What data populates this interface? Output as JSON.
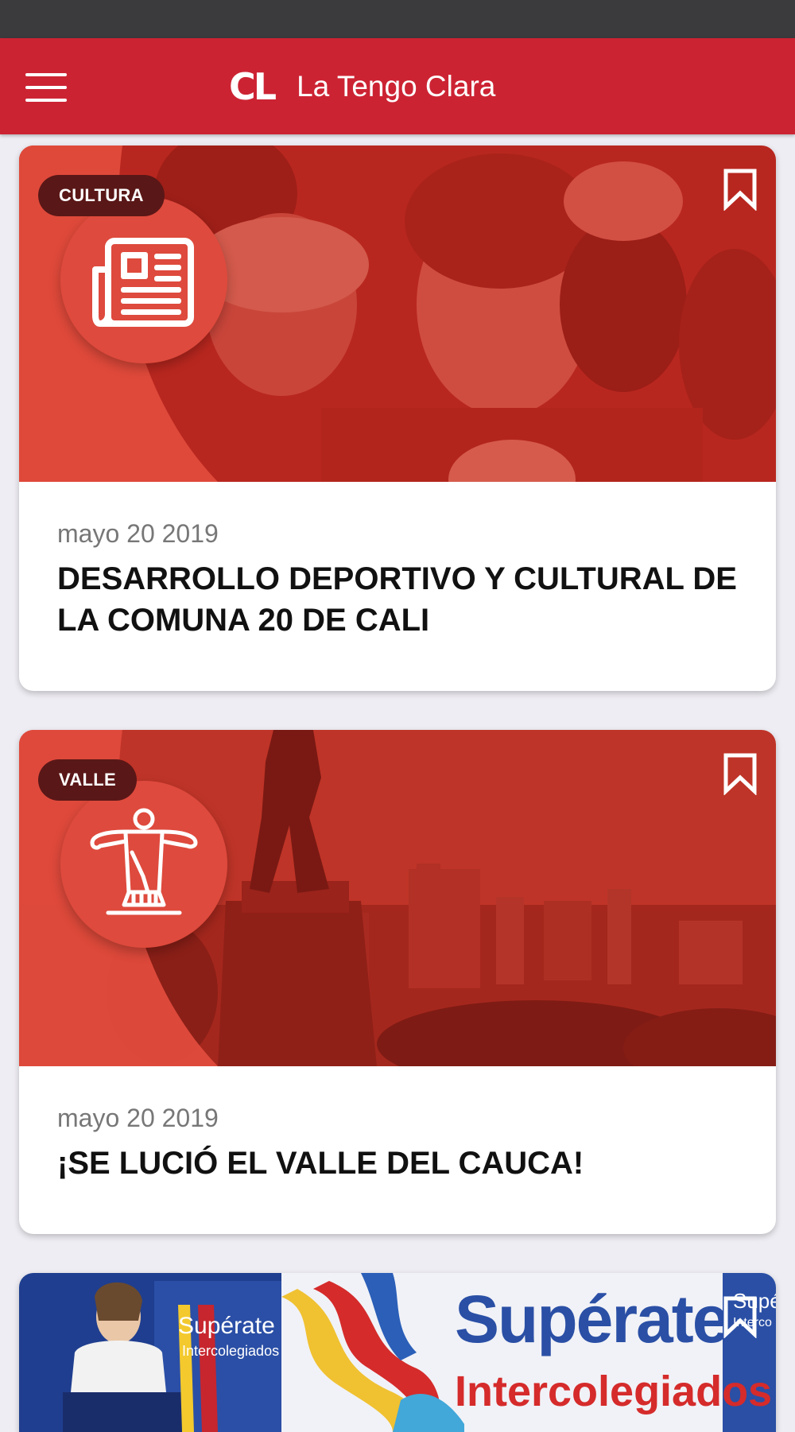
{
  "app_bar": {
    "logo_text": "CL",
    "title": "La Tengo Clara",
    "bg_color": "#cc2333"
  },
  "cards": [
    {
      "category": "CULTURA",
      "icon": "newspaper-icon",
      "date": "mayo 20 2019",
      "title": "DESARROLLO DEPORTIVO Y CULTURAL DE LA COMUNA 20 DE CALI",
      "bookmarked": false
    },
    {
      "category": "VALLE",
      "icon": "christ-statue-icon",
      "date": "mayo 20 2019",
      "title": "¡SE LUCIÓ EL VALLE DEL CAUCA!",
      "bookmarked": false
    },
    {
      "banner_texts": [
        "Supérate",
        "Intercolegiados",
        "Supérate",
        "Intercolegiados",
        "Supér",
        "Interco"
      ],
      "bookmarked": false
    }
  ]
}
